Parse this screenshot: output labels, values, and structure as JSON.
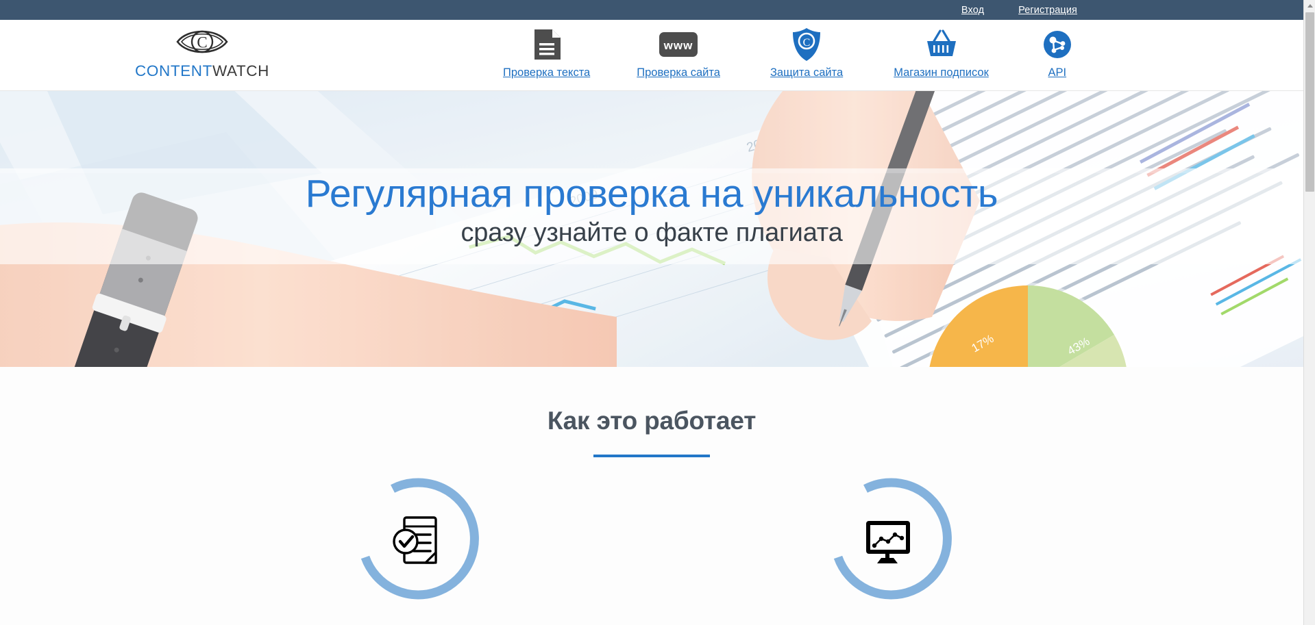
{
  "topbar": {
    "login_label": "Вход",
    "register_label": "Регистрация",
    "background_color": "#3d5670"
  },
  "logo": {
    "icon": "eye-copyright-icon",
    "word1": "CONTENT",
    "word2": "WATCH",
    "word1_color": "#2277c8",
    "word2_color": "#3b3b3b"
  },
  "nav": {
    "items": [
      {
        "label": "Проверка текста",
        "icon": "document-lines-icon",
        "icon_color": "#4d4d4d"
      },
      {
        "label": "Проверка сайта",
        "icon": "www-badge-icon",
        "icon_color": "#4d4d4d"
      },
      {
        "label": "Защита сайта",
        "icon": "shield-copyright-icon",
        "icon_color": "#1e6fc0"
      },
      {
        "label": "Магазин подписок",
        "icon": "shopping-basket-icon",
        "icon_color": "#1e6fc0"
      },
      {
        "label": "API",
        "icon": "api-nodes-icon",
        "icon_color": "#1e6fc0"
      }
    ],
    "link_color": "#1e6fc0"
  },
  "hero": {
    "title": "Регулярная проверка на уникальность",
    "subtitle": "сразу узнайте о факте плагиата",
    "title_color": "#2a7ad1",
    "subtitle_color": "#38414a",
    "background_image": "hand-with-pen-over-charts-photo"
  },
  "how_it_works": {
    "title": "Как это работает",
    "title_color": "#4b5560",
    "accent_color": "#2277c8",
    "steps": [
      {
        "icon": "document-check-icon",
        "ring_color": "#84b2dd"
      },
      {
        "icon": "monitor-chart-icon",
        "ring_color": "#84b2dd"
      }
    ]
  },
  "scrollbar": {
    "thumb_color": "#c1c1c1",
    "track_color": "#f1f1f1"
  }
}
